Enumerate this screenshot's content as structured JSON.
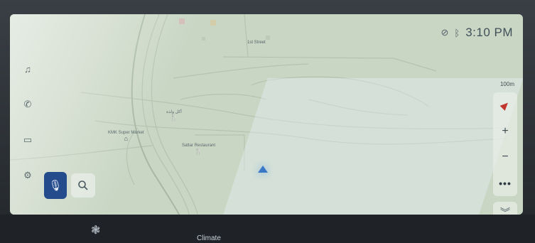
{
  "status": {
    "time": "3:10 PM",
    "icons": [
      "location-off-icon",
      "bluetooth-icon"
    ]
  },
  "map": {
    "street_label": "1st Street",
    "pois": [
      {
        "name": "KMK Super Market",
        "icon": "shopping-icon"
      },
      {
        "name": "Sattar Restaurant",
        "icon": "restaurant-icon"
      },
      {
        "name": "أكل ولذة",
        "icon": "restaurant-icon"
      }
    ],
    "scale": "100m"
  },
  "left_rail": {
    "icons": [
      "music-icon",
      "phone-icon",
      "car-icon",
      "settings-icon"
    ]
  },
  "controls": {
    "zoom_in": "+",
    "zoom_out": "−",
    "more": "•••",
    "collapse": "︾"
  },
  "bottom_bar": {
    "climate_label": "Climate"
  },
  "colors": {
    "map_bg": "#c9d6c4",
    "mic_button": "#244b8c",
    "nav_arrow": "#3a78c8",
    "compass_red": "#c0362e"
  }
}
